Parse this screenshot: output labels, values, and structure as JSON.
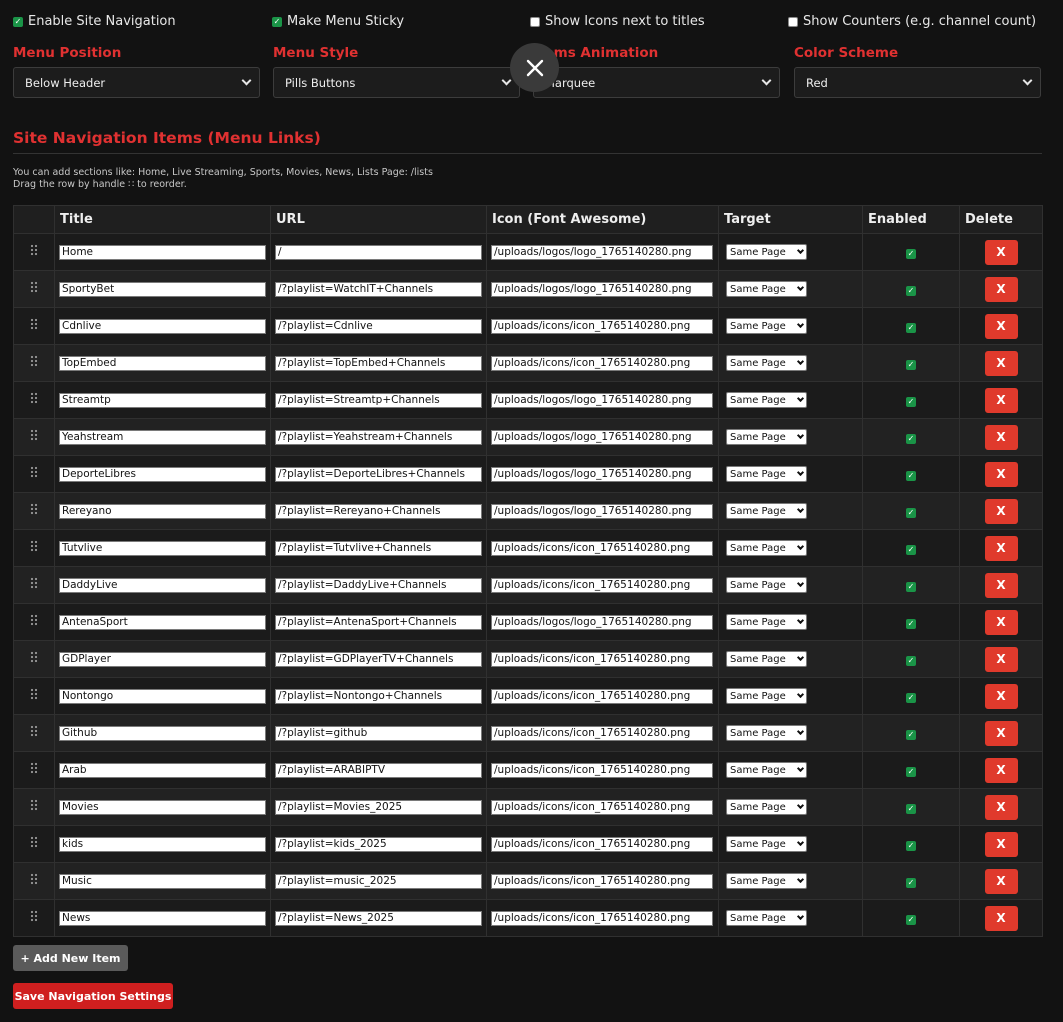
{
  "options": {
    "enable_nav": {
      "label": "Enable Site Navigation",
      "checked": true
    },
    "sticky": {
      "label": "Make Menu Sticky",
      "checked": true
    },
    "icons": {
      "label": "Show Icons next to titles",
      "checked": false
    },
    "counters": {
      "label": "Show Counters (e.g. channel count)",
      "checked": false
    }
  },
  "selects": {
    "position": {
      "label": "Menu Position",
      "value": "Below Header"
    },
    "style": {
      "label": "Menu Style",
      "value": "Pills Buttons"
    },
    "animation": {
      "label": "Items Animation",
      "value": "Marquee"
    },
    "scheme": {
      "label": "Color Scheme",
      "value": "Red"
    }
  },
  "section": {
    "title": "Site Navigation Items (Menu Links)",
    "help_line1": "You can add sections like: Home, Live Streaming, Sports, Movies, News, Lists Page: /lists",
    "help_line2": "Drag the row by handle ∷ to reorder."
  },
  "table": {
    "headers": {
      "title": "Title",
      "url": "URL",
      "icon": "Icon (Font Awesome)",
      "target": "Target",
      "enabled": "Enabled",
      "delete": "Delete"
    },
    "delete_label": "X",
    "rows": [
      {
        "title": "Home",
        "url": "/",
        "icon": "/uploads/logos/logo_1765140280.png",
        "target": "Same Page",
        "enabled": true
      },
      {
        "title": "SportyBet",
        "url": "/?playlist=WatchIT+Channels",
        "icon": "/uploads/logos/logo_1765140280.png",
        "target": "Same Page",
        "enabled": true
      },
      {
        "title": "Cdnlive",
        "url": "/?playlist=Cdnlive",
        "icon": "/uploads/icons/icon_1765140280.png",
        "target": "Same Page",
        "enabled": true
      },
      {
        "title": "TopEmbed",
        "url": "/?playlist=TopEmbed+Channels",
        "icon": "/uploads/icons/icon_1765140280.png",
        "target": "Same Page",
        "enabled": true
      },
      {
        "title": "Streamtp",
        "url": "/?playlist=Streamtp+Channels",
        "icon": "/uploads/logos/logo_1765140280.png",
        "target": "Same Page",
        "enabled": true
      },
      {
        "title": "Yeahstream",
        "url": "/?playlist=Yeahstream+Channels",
        "icon": "/uploads/logos/logo_1765140280.png",
        "target": "Same Page",
        "enabled": true
      },
      {
        "title": "DeporteLibres",
        "url": "/?playlist=DeporteLibres+Channels",
        "icon": "/uploads/logos/logo_1765140280.png",
        "target": "Same Page",
        "enabled": true
      },
      {
        "title": "Rereyano",
        "url": "/?playlist=Rereyano+Channels",
        "icon": "/uploads/logos/logo_1765140280.png",
        "target": "Same Page",
        "enabled": true
      },
      {
        "title": "Tutvlive",
        "url": "/?playlist=Tutvlive+Channels",
        "icon": "/uploads/icons/icon_1765140280.png",
        "target": "Same Page",
        "enabled": true
      },
      {
        "title": "DaddyLive",
        "url": "/?playlist=DaddyLive+Channels",
        "icon": "/uploads/icons/icon_1765140280.png",
        "target": "Same Page",
        "enabled": true
      },
      {
        "title": "AntenaSport",
        "url": "/?playlist=AntenaSport+Channels",
        "icon": "/uploads/logos/logo_1765140280.png",
        "target": "Same Page",
        "enabled": true
      },
      {
        "title": "GDPlayer",
        "url": "/?playlist=GDPlayerTV+Channels",
        "icon": "/uploads/icons/icon_1765140280.png",
        "target": "Same Page",
        "enabled": true
      },
      {
        "title": "Nontongo",
        "url": "/?playlist=Nontongo+Channels",
        "icon": "/uploads/icons/icon_1765140280.png",
        "target": "Same Page",
        "enabled": true
      },
      {
        "title": "Github",
        "url": "/?playlist=github",
        "icon": "/uploads/icons/icon_1765140280.png",
        "target": "Same Page",
        "enabled": true
      },
      {
        "title": "Arab",
        "url": "/?playlist=ARABIPTV",
        "icon": "/uploads/icons/icon_1765140280.png",
        "target": "Same Page",
        "enabled": true
      },
      {
        "title": "Movies",
        "url": "/?playlist=Movies_2025",
        "icon": "/uploads/icons/icon_1765140280.png",
        "target": "Same Page",
        "enabled": true
      },
      {
        "title": "kids",
        "url": "/?playlist=kids_2025",
        "icon": "/uploads/icons/icon_1765140280.png",
        "target": "Same Page",
        "enabled": true
      },
      {
        "title": "Music",
        "url": "/?playlist=music_2025",
        "icon": "/uploads/icons/icon_1765140280.png",
        "target": "Same Page",
        "enabled": true
      },
      {
        "title": "News",
        "url": "/?playlist=News_2025",
        "icon": "/uploads/icons/icon_1765140280.png",
        "target": "Same Page",
        "enabled": true
      }
    ]
  },
  "buttons": {
    "add": "+ Add New Item",
    "save": "Save Navigation Settings"
  },
  "colors": {
    "accent_red": "#e03131",
    "delete_red": "#e03a2c",
    "check_green": "#1a9447",
    "background": "#121212"
  },
  "icons": {
    "close": "close-icon",
    "handle": "drag-handle-icon",
    "dropdown": "chevron-down-icon",
    "check": "checkmark-icon"
  }
}
